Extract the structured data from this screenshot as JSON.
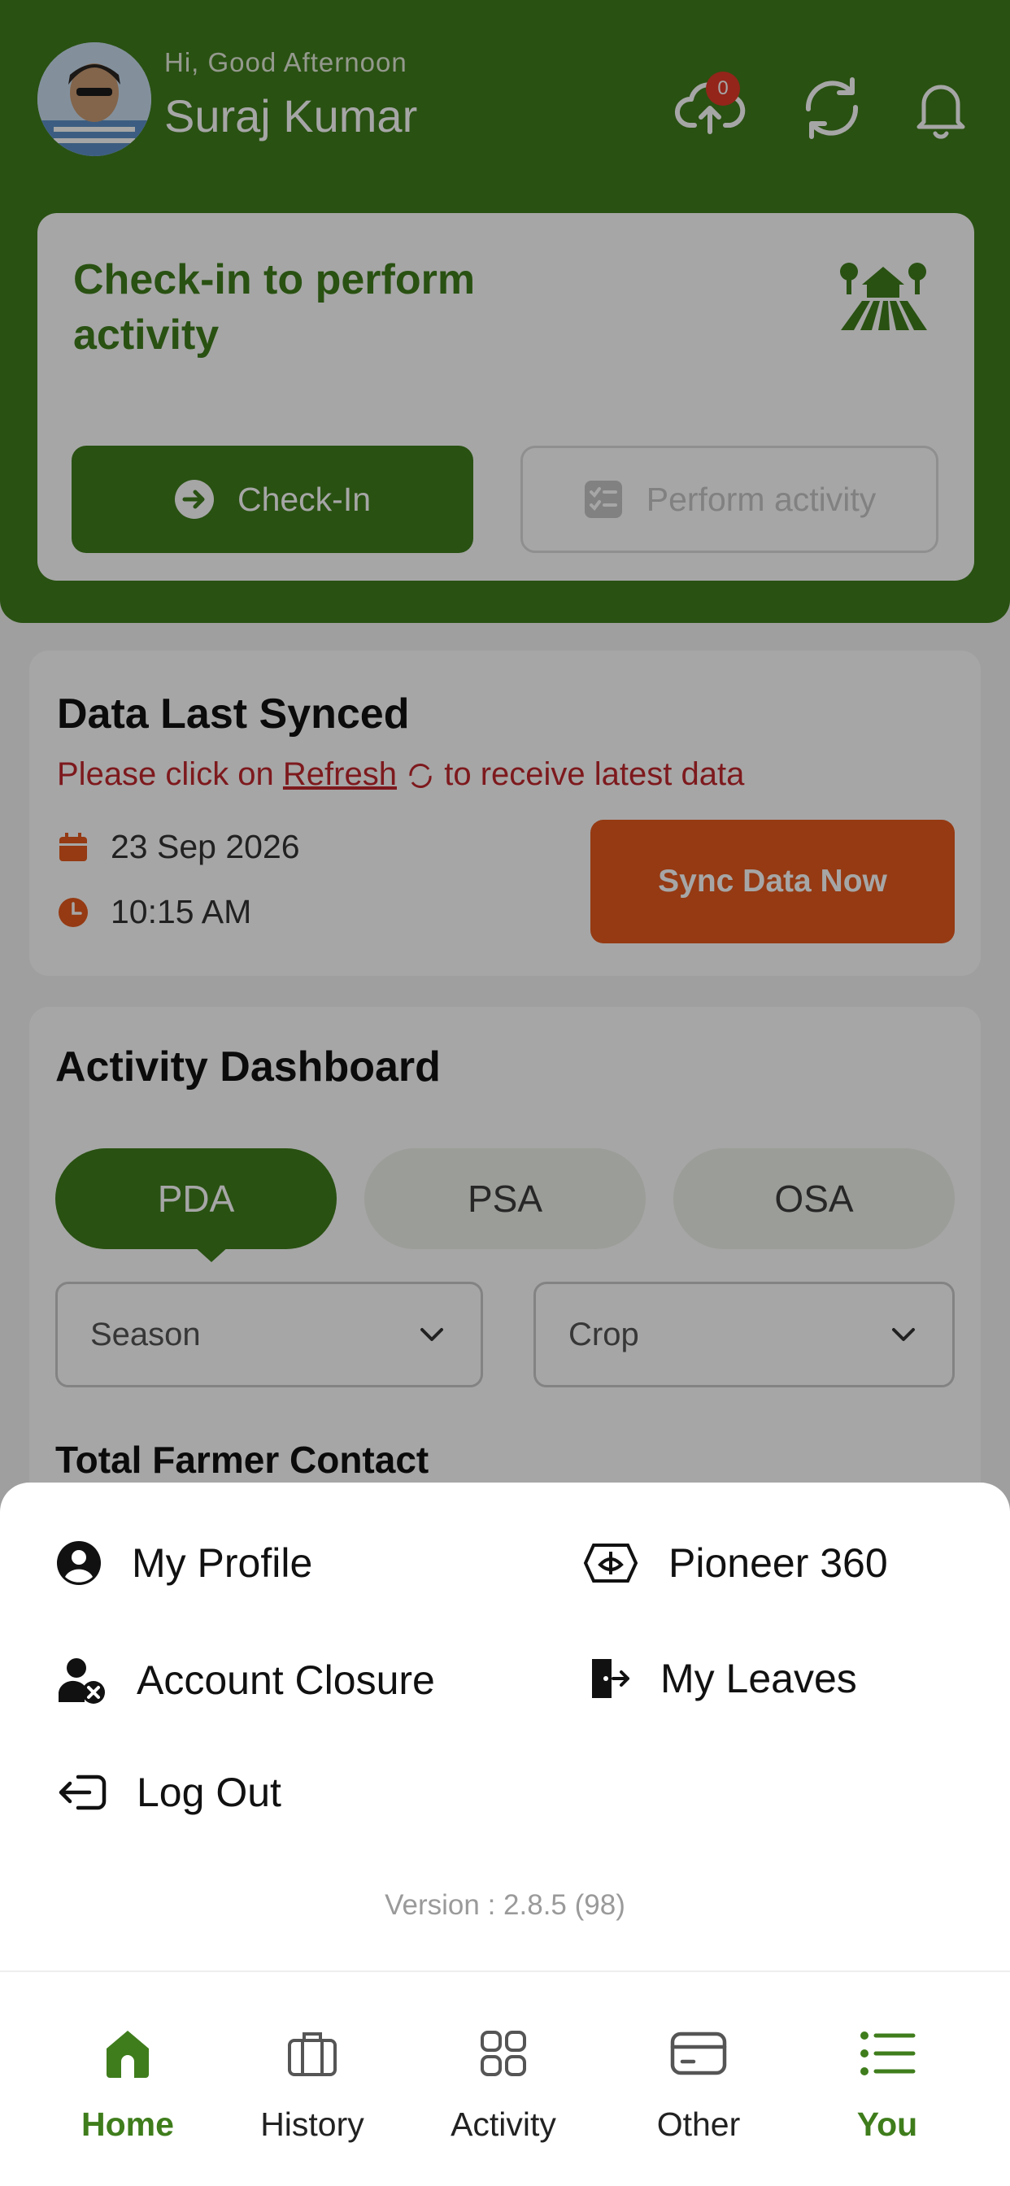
{
  "header": {
    "greeting": "Hi, Good Afternoon",
    "user_name": "Suraj Kumar",
    "upload_badge_count": "0",
    "icons": [
      "cloud-upload-icon",
      "refresh-icon",
      "bell-icon"
    ]
  },
  "checkin_card": {
    "title": "Check-in to perform activity",
    "checkin_button": "Check-In",
    "perform_button": "Perform activity"
  },
  "sync_card": {
    "title": "Data Last Synced",
    "message_prefix": "Please click on",
    "message_link": "Refresh",
    "message_suffix": "to receive latest data",
    "date": "23 Sep 2026",
    "time": "10:15 AM",
    "sync_button": "Sync Data Now"
  },
  "dashboard": {
    "title": "Activity Dashboard",
    "tabs": [
      {
        "label": "PDA",
        "active": true
      },
      {
        "label": "PSA",
        "active": false
      },
      {
        "label": "OSA",
        "active": false
      }
    ],
    "season_select": "Season",
    "crop_select": "Crop",
    "section_title": "Total Farmer Contact"
  },
  "menu": {
    "items": [
      {
        "label": "My Profile",
        "icon": "user-circle-icon"
      },
      {
        "label": "Pioneer 360",
        "icon": "pioneer-logo-icon"
      },
      {
        "label": "Account Closure",
        "icon": "user-remove-icon"
      },
      {
        "label": "My Leaves",
        "icon": "leave-exit-icon"
      },
      {
        "label": "Log Out",
        "icon": "logout-icon"
      }
    ],
    "version": "Version : 2.8.5 (98)"
  },
  "nav": {
    "items": [
      {
        "label": "Home",
        "icon": "home-icon",
        "active": true
      },
      {
        "label": "History",
        "icon": "briefcase-icon",
        "active": false
      },
      {
        "label": "Activity",
        "icon": "grid-icon",
        "active": false
      },
      {
        "label": "Other",
        "icon": "card-icon",
        "active": false
      },
      {
        "label": "You",
        "icon": "list-icon",
        "active": true
      }
    ]
  },
  "colors": {
    "brand_green": "#3f7d1c",
    "accent_orange": "#e55a1e",
    "alert_red": "#c1272d"
  }
}
